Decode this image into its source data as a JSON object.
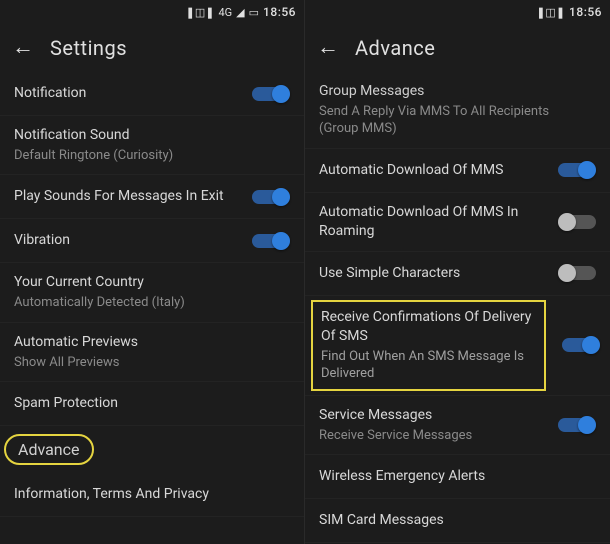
{
  "left": {
    "status": {
      "clock": "18:56",
      "data": "4G"
    },
    "title": "Settings",
    "items": {
      "notification": {
        "label": "Notification",
        "on": true
      },
      "notif_sound": {
        "label": "Notification Sound",
        "sub": "Default Ringtone (Curiosity)"
      },
      "play_sounds": {
        "label": "Play Sounds For Messages In Exit",
        "on": true
      },
      "vibration": {
        "label": "Vibration",
        "on": true
      },
      "country": {
        "label": "Your Current Country",
        "sub": "Automatically Detected (Italy)"
      },
      "auto_previews": {
        "label": "Automatic Previews",
        "sub": "Show All Previews"
      },
      "spam": {
        "label": "Spam Protection"
      },
      "advance": {
        "label": "Advance"
      },
      "info": {
        "label": "Information, Terms And Privacy"
      }
    }
  },
  "right": {
    "status": {
      "clock": "18:56"
    },
    "title": "Advance",
    "items": {
      "group_msgs": {
        "label": "Group Messages",
        "sub": "Send A Reply Via MMS To All Recipients (Group MMS)"
      },
      "auto_mms": {
        "label": "Automatic Download Of MMS",
        "on": true
      },
      "auto_mms_roaming": {
        "label": "Automatic Download Of MMS In Roaming",
        "on": false
      },
      "simple_chars": {
        "label": "Use Simple Characters",
        "on": false
      },
      "delivery": {
        "label": "Receive Confirmations Of Delivery Of SMS",
        "sub": "Find Out When An SMS Message Is Delivered",
        "on": true
      },
      "service_msgs": {
        "label": "Service Messages",
        "sub": "Receive Service Messages",
        "on": true
      },
      "emergency": {
        "label": "Wireless Emergency Alerts"
      },
      "sim": {
        "label": "SIM Card Messages"
      }
    }
  }
}
